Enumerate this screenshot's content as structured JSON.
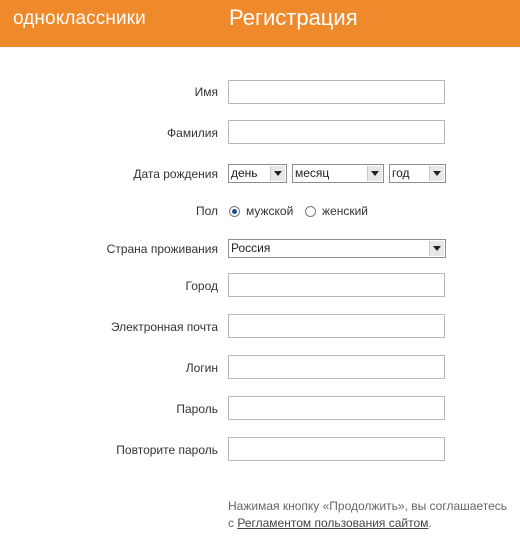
{
  "header": {
    "brand": "одноклассники",
    "title": "Регистрация",
    "color": "#ef8a2c"
  },
  "form": {
    "first_name": {
      "label": "Имя",
      "value": ""
    },
    "last_name": {
      "label": "Фамилия",
      "value": ""
    },
    "birth_date": {
      "label": "Дата рождения",
      "day": "день",
      "month": "месяц",
      "year": "год"
    },
    "gender": {
      "label": "Пол",
      "options": [
        "мужской",
        "женский"
      ],
      "selected": "мужской"
    },
    "country": {
      "label": "Страна проживания",
      "value": "Россия"
    },
    "city": {
      "label": "Город",
      "value": ""
    },
    "email": {
      "label": "Электронная почта",
      "value": ""
    },
    "login": {
      "label": "Логин",
      "value": ""
    },
    "password": {
      "label": "Пароль",
      "value": ""
    },
    "password_repeat": {
      "label": "Повторите пароль",
      "value": ""
    }
  },
  "terms": {
    "text_before": "Нажимая кнопку «Продолжить», вы соглашаетесь",
    "prefix": "с ",
    "link": "Регламентом пользования сайтом",
    "suffix": "."
  }
}
